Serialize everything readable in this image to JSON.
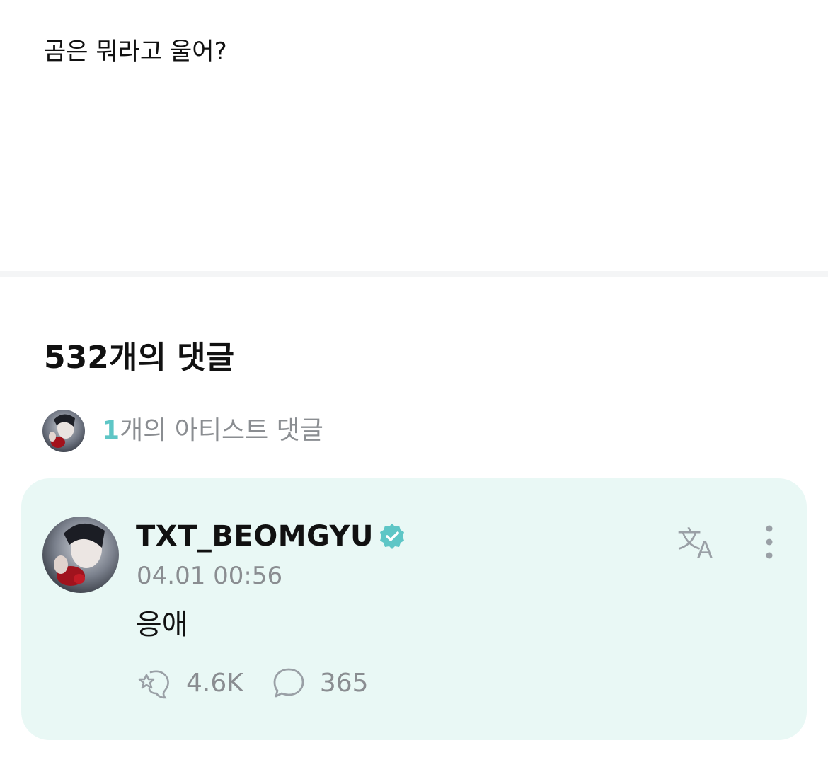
{
  "post": {
    "text": "곰은 뭐라고 울어?"
  },
  "comments_section": {
    "count_label": "532개의 댓글",
    "artist_comments": {
      "count": "1",
      "label": "개의 아티스트 댓글"
    }
  },
  "artist_comment": {
    "username": "TXT_BEOMGYU",
    "verified": true,
    "timestamp": "04.01 00:56",
    "body": "응애",
    "likes": "4.6K",
    "replies": "365"
  },
  "colors": {
    "accent": "#5ec6c6",
    "card_background": "#e9f8f5",
    "muted_text": "#8a8d91",
    "icon_gray": "#9aa0a6"
  },
  "icons": {
    "translate": "translate-icon",
    "more": "more-vertical-icon",
    "like": "cheer-icon",
    "reply": "speech-bubble-icon",
    "verified": "verified-badge-icon"
  }
}
